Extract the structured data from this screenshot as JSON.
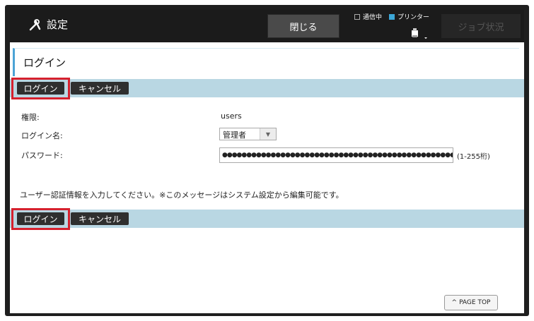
{
  "header": {
    "title": "設定",
    "title_icon": "tools-icon",
    "close_label": "閉じる",
    "status_comm_label": "通信中",
    "status_printer_label": "プリンター",
    "job_status_label": "ジョブ状況",
    "colors": {
      "bar": "#1b1b1b",
      "accent": "#3ca7d8"
    }
  },
  "page": {
    "heading": "ログイン",
    "login_button": "ログイン",
    "cancel_button": "キャンセル",
    "fields": {
      "authority_label": "権限:",
      "authority_value": "users",
      "login_name_label": "ログイン名:",
      "login_name_value": "管理者",
      "password_label": "パスワード:",
      "password_mask": "●●●●●●●●●●●●●●●●●●●●●●●●●●●●●●●●●●●●●●●●●●●●●●●●●●●●●●●●●●●●●●●●●●●●●",
      "password_hint": "(1-255桁)"
    },
    "message": "ユーザー認証情報を入力してください。※このメッセージはシステム設定から編集可能です。",
    "page_top_label": "PAGE TOP",
    "colors": {
      "button_bar": "#b9d7e3",
      "highlight": "#d6212e"
    }
  }
}
